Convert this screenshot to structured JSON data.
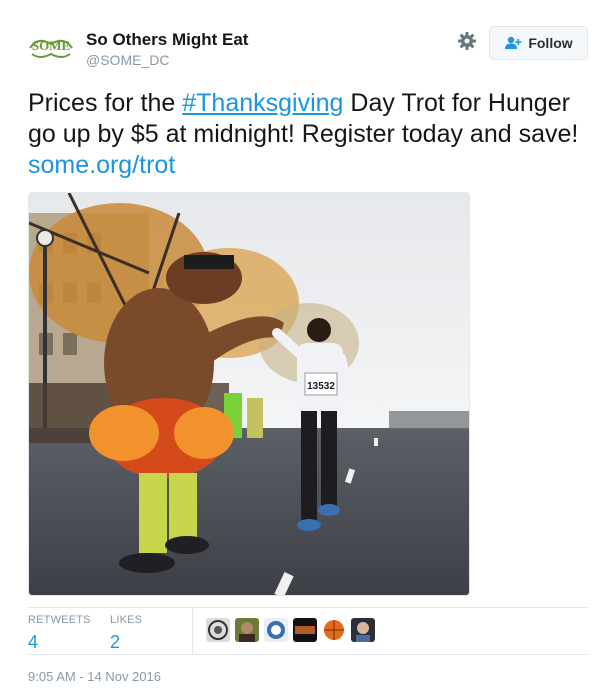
{
  "account": {
    "display_name": "So Others Might Eat",
    "screen_name": "@SOME_DC",
    "logo_text": "SOME"
  },
  "header": {
    "follow_label": "Follow",
    "settings_icon": "gear-icon",
    "follow_icon": "add-user-icon"
  },
  "tweet": {
    "text_before": "Prices for the ",
    "hashtag": "#Thanksgiving",
    "text_after": " Day Trot for Hunger go up by $5 at midnight! Register today and save! ",
    "link": "some.org/trot"
  },
  "media": {
    "bib_number": "13532"
  },
  "stats": {
    "retweets_label": "RETWEETS",
    "retweets_count": "4",
    "likes_label": "LIKES",
    "likes_count": "2"
  },
  "timestamp": "9:05 AM - 14 Nov 2016",
  "colors": {
    "link": "#1b95e0",
    "muted": "#8899a6",
    "border": "#e1e8ed",
    "logo_green": "#6a9a3a"
  }
}
